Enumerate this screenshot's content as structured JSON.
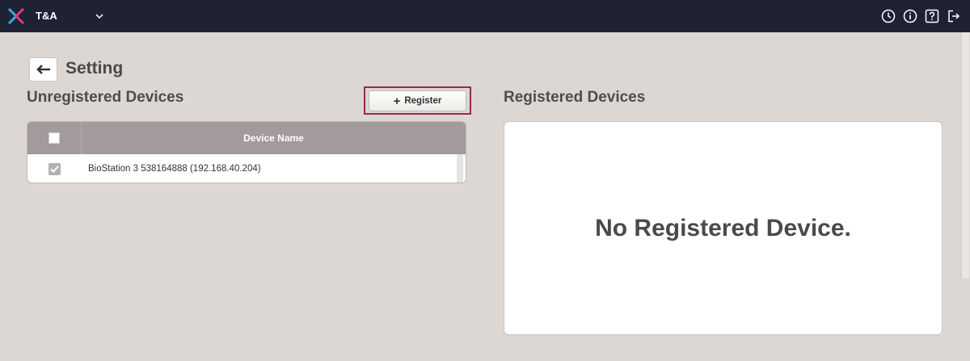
{
  "app": {
    "name": "T&A"
  },
  "topbar": {
    "icons": [
      "clock-icon",
      "info-icon",
      "help-icon",
      "logout-icon"
    ]
  },
  "page": {
    "title": "Setting"
  },
  "unregistered": {
    "title": "Unregistered Devices",
    "register_label": "Register",
    "table": {
      "columns": [
        "Device Name"
      ],
      "rows": [
        {
          "name": "BioStation 3 538164888 (192.168.40.204)",
          "checked": true
        }
      ]
    }
  },
  "registered": {
    "title": "Registered Devices",
    "empty_message": "No Registered Device."
  },
  "colors": {
    "topbar": "#1e2233",
    "background": "#dcd7d3",
    "table_header": "#a39a9b",
    "highlight": "#9a2a4a"
  }
}
